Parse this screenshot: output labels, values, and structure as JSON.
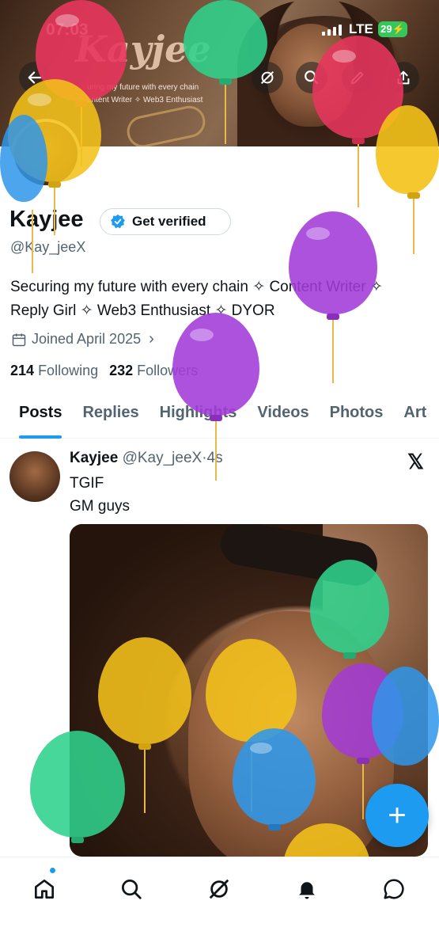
{
  "status_bar": {
    "time": "07:03",
    "network": "LTE",
    "battery": "29"
  },
  "banner": {
    "logo_text": "Kayjee",
    "tagline_line1": "uring my future with every chain",
    "tagline_line2": "ontent Writer ✧ Web3 Enthusiast"
  },
  "profile": {
    "name": "Kayjee",
    "verify_label": "Get verified",
    "handle": "@Kay_jeeX",
    "bio_line1": "Securing my future with every chain ✧ Content Writer ✧",
    "bio_line2": "Reply Girl ✧ Web3 Enthusiast ✧ DYOR",
    "joined": "Joined April 2025",
    "following_count": "214",
    "following_label": "Following",
    "followers_count": "232",
    "followers_label": "Followers"
  },
  "tabs": [
    {
      "label": "Posts",
      "active": true
    },
    {
      "label": "Replies"
    },
    {
      "label": "Highlights"
    },
    {
      "label": "Videos"
    },
    {
      "label": "Photos"
    },
    {
      "label": "Art"
    }
  ],
  "post": {
    "author": "Kayjee",
    "handle": "@Kay_jeeX",
    "separator": "·",
    "time": "4s",
    "line1": "TGIF",
    "line2": "GM guys",
    "source_icon": "x-logo-icon"
  },
  "fab": {
    "label": "+"
  },
  "icons": {
    "back": "arrow-left-icon",
    "grok": "grok-icon",
    "search": "search-icon",
    "edit": "pencil-icon",
    "share": "share-icon",
    "verified": "verified-badge-icon",
    "calendar": "calendar-icon",
    "home": "home-icon",
    "notifications": "bell-icon",
    "messages": "chat-bubble-icon"
  },
  "colors": {
    "accent": "#1d9bf0",
    "text": "#0f1419",
    "secondary": "#536471",
    "battery": "#34c759",
    "balloon_red": "#e8365d",
    "balloon_yellow": "#f4c21a",
    "balloon_green": "#2fd18c",
    "balloon_blue": "#2e97ea",
    "balloon_purple": "#a23ad8"
  }
}
